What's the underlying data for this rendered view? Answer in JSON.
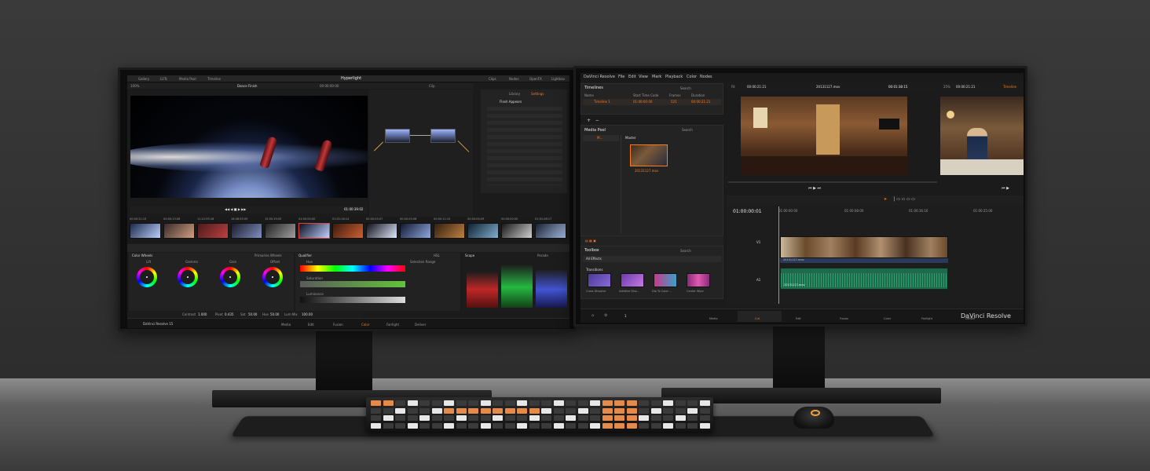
{
  "left_app": {
    "top_tabs": [
      "Gallery",
      "LUTs",
      "Media Pool",
      "Timeline"
    ],
    "project_title": "Hyperlight",
    "top_right_tabs": [
      "Clips",
      "Nodes",
      "OpenFX",
      "Lightbox"
    ],
    "viewer": {
      "zoom": "100%",
      "clip_name": "Dance Finish",
      "timecode": "00:00:00:00",
      "playhead_timecode": "01:00:39:02"
    },
    "node_editor_label": "Clip",
    "effects_tabs": [
      "Library",
      "Settings"
    ],
    "effect_name": "Flash Appears",
    "thumbnails": [
      "00:00:21:15",
      "00:00:13:08",
      "11:12:55:18",
      "16:46:55:09",
      "15:00:19:05",
      "01:00:00:00",
      "01:01:16:14",
      "00:00:05:07",
      "00:00:05:06",
      "00:00:11:15",
      "00:00:00:09",
      "00:00:00:00",
      "01:01:06:17"
    ],
    "color_wheels": {
      "title": "Color Wheels",
      "mode": "Primaries Wheels",
      "labels": [
        "Lift",
        "Gamma",
        "Gain",
        "Offset"
      ]
    },
    "qualifier": {
      "title": "Qualifier",
      "mode": "HSL",
      "hue_label": "Hue",
      "sat_label": "Saturation",
      "lum_label": "Luminance",
      "selection_range": "Selection Range"
    },
    "scopes": {
      "title": "Scope",
      "mode": "Parade"
    },
    "bottom_pages": [
      "Media",
      "Edit",
      "Fusion",
      "Color",
      "Fairlight",
      "Deliver"
    ],
    "brand": "DaVinci Resolve 15",
    "bottom_values": [
      "Contrast",
      "1.000",
      "Pivot",
      "0.435",
      "Sat",
      "50.00",
      "Hue",
      "50.00",
      "Lum Mix",
      "100.00"
    ]
  },
  "right_app": {
    "menu": [
      "DaVinci Resolve",
      "File",
      "Edit",
      "View",
      "Mark",
      "Playback",
      "Color",
      "Nodes"
    ],
    "timelines_panel": {
      "title": "Timelines",
      "search_placeholder": "Search",
      "columns": [
        "Name",
        "Start Time Code",
        "Frames",
        "Duration"
      ],
      "row": {
        "name": "Timeline 1",
        "start": "01:00:00:00",
        "frames": "525",
        "duration": "00:00:21:21"
      }
    },
    "source_viewer": {
      "fit": "Fit",
      "timecode": "00:00:21:21",
      "clip_name": "20131127.mov",
      "duration": "00:01:38:15"
    },
    "timeline_viewer": {
      "zoom": "25%",
      "timecode": "00:00:21:21",
      "title": "Timeline"
    },
    "media_pool": {
      "title": "Media Pool",
      "folder": "Master",
      "bin_label": "M...",
      "clip_name": "20131127.mov",
      "search_placeholder": "Search"
    },
    "toolbox": {
      "title": "Toolbox",
      "search_placeholder": "Search",
      "all_effects": "All Effects",
      "transitions_title": "Transitions",
      "transitions": [
        "Cross Dissolve",
        "Additive Diss...",
        "Dip To Color ...",
        "Center Wipe"
      ]
    },
    "timeline": {
      "current_timecode": "01:00:00:01",
      "ruler": [
        "01:00:00:00",
        "01:00:08:00",
        "01:00:16:16",
        "01:00:25:00"
      ],
      "tracks": [
        "V1",
        "A1"
      ],
      "audio_clip": "20131127.mov",
      "audio_clip_sub": "20131127.mov"
    },
    "page_number": "1",
    "bottom_pages": [
      "Media",
      "Cut",
      "Edit",
      "Fusion",
      "Color",
      "Fairlight",
      "Deliver"
    ],
    "brand": "DaVinci Resolve"
  },
  "colors": {
    "accent": "#ff7a1a",
    "panel": "#232323",
    "background": "#1b1b1b",
    "audio": "#1f6a4a"
  }
}
